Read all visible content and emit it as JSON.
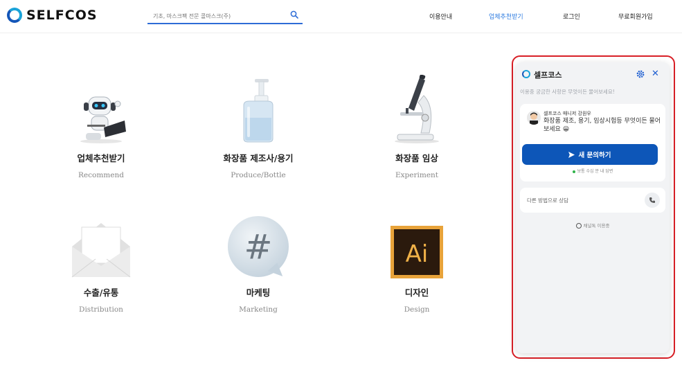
{
  "header": {
    "logo_text": "SELFCOS",
    "search": {
      "placeholder": "기초, 마스크팩 전문 콜마스크(주)"
    },
    "nav": [
      "이용안내",
      "업체추천받기",
      "로그인",
      "무료회원가입"
    ],
    "active_nav_index": 1
  },
  "categories": [
    {
      "title": "업체추천받기",
      "subtitle": "Recommend",
      "icon": "robot-laptop-image"
    },
    {
      "title": "화장품 제조사/용기",
      "subtitle": "Produce/Bottle",
      "icon": "pump-bottle-image"
    },
    {
      "title": "화장품 임상",
      "subtitle": "Experiment",
      "icon": "microscope-image"
    },
    {
      "title": "수출/유통",
      "subtitle": "Distribution",
      "icon": "envelope-image"
    },
    {
      "title": "마케팅",
      "subtitle": "Marketing",
      "icon": "hashtag-bubble-image"
    },
    {
      "title": "디자인",
      "subtitle": "Design",
      "icon": "illustrator-ai-logo"
    }
  ],
  "chat": {
    "title": "셀프코스",
    "subtitle": "이용중 궁금한 사항은 무엇이든 물어보세요!",
    "manager_name": "셀프코스 매니저 강원우",
    "message": "화장품 제조, 용기, 임상시험등 무엇이든 물어보세요 😀",
    "cta_label": "새 문의하기",
    "reply_info": "보통 수십 분 내 답변",
    "other_methods": "다른 방법으로 상담",
    "powered_by": "채널톡 이용중"
  },
  "colors": {
    "accent": "#2d7be0",
    "cta": "#0d56b8",
    "highlight_border": "#d81f26"
  }
}
